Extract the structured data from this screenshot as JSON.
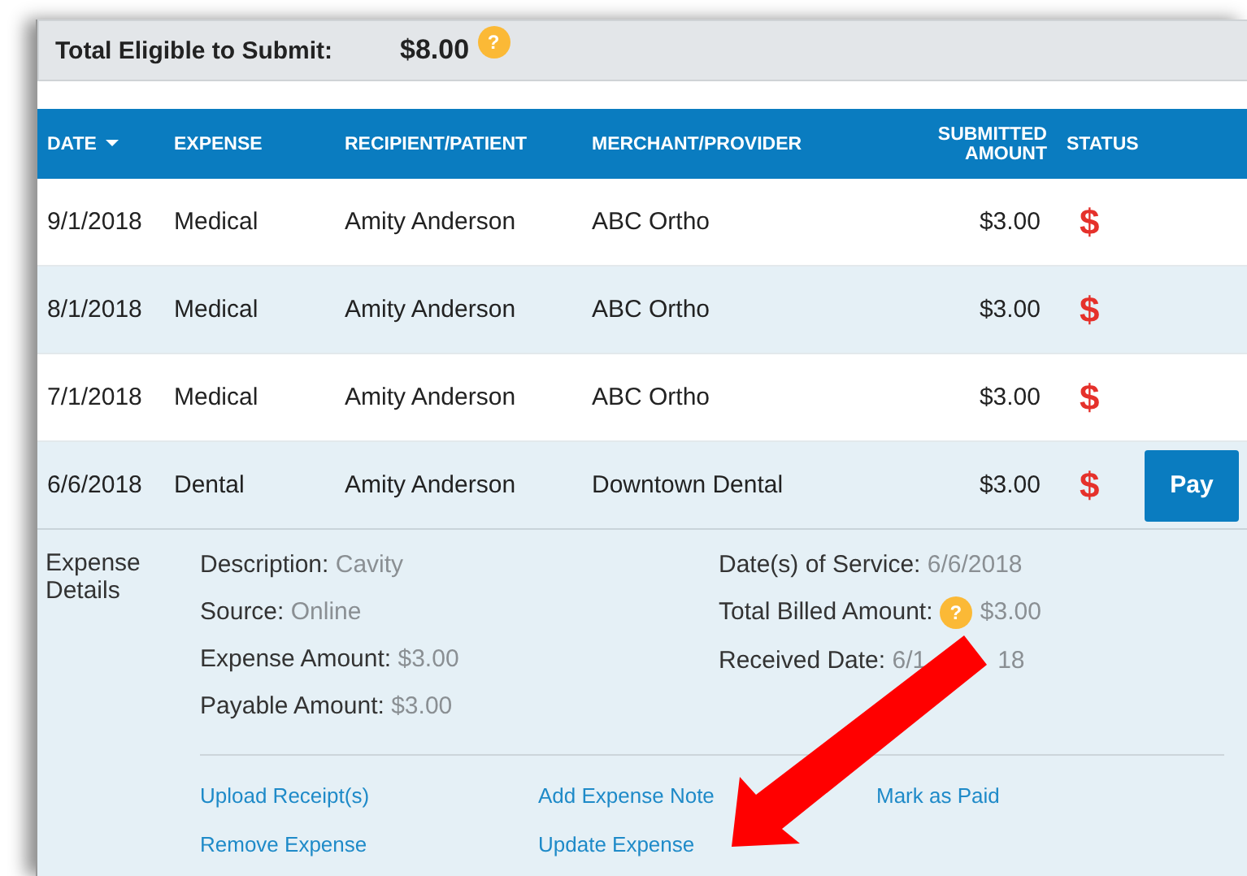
{
  "summary": {
    "label": "Total Eligible to Submit:",
    "amount": "$8.00",
    "help_icon": "?"
  },
  "table": {
    "columns": [
      {
        "label": "DATE",
        "sorted": true
      },
      {
        "label": "EXPENSE",
        "sorted": false
      },
      {
        "label": "RECIPIENT/PATIENT",
        "sorted": false
      },
      {
        "label": "MERCHANT/PROVIDER",
        "sorted": false
      },
      {
        "label": "SUBMITTED AMOUNT",
        "sorted": false
      },
      {
        "label": "STATUS",
        "sorted": false
      }
    ],
    "rows": [
      {
        "date": "9/1/2018",
        "expense": "Medical",
        "recipient": "Amity Anderson",
        "merchant": "ABC Ortho",
        "amount": "$3.00",
        "status": "$",
        "expanded": false
      },
      {
        "date": "8/1/2018",
        "expense": "Medical",
        "recipient": "Amity Anderson",
        "merchant": "ABC Ortho",
        "amount": "$3.00",
        "status": "$",
        "expanded": false
      },
      {
        "date": "7/1/2018",
        "expense": "Medical",
        "recipient": "Amity Anderson",
        "merchant": "ABC Ortho",
        "amount": "$3.00",
        "status": "$",
        "expanded": false
      },
      {
        "date": "6/6/2018",
        "expense": "Dental",
        "recipient": "Amity Anderson",
        "merchant": "Downtown Dental",
        "amount": "$3.00",
        "status": "$",
        "expanded": true,
        "action": "Pay"
      }
    ]
  },
  "details": {
    "heading": "Expense Details",
    "left": [
      {
        "label": "Description:",
        "value": "Cavity"
      },
      {
        "label": "Source:",
        "value": "Online"
      },
      {
        "label": "Expense Amount:",
        "value": "$3.00"
      },
      {
        "label": "Payable Amount:",
        "value": "$3.00"
      }
    ],
    "right": [
      {
        "label": "Date(s) of Service:",
        "value": "6/6/2018"
      },
      {
        "label": "Total Billed Amount:",
        "help_icon": "?",
        "value": "$3.00"
      },
      {
        "label": "Received Date:",
        "value_fragments": [
          "6/1",
          "18"
        ]
      }
    ],
    "links": [
      [
        "Upload Receipt(s)",
        "Add Expense Note",
        "Mark as Paid"
      ],
      [
        "Remove Expense",
        "Update Expense"
      ]
    ]
  }
}
